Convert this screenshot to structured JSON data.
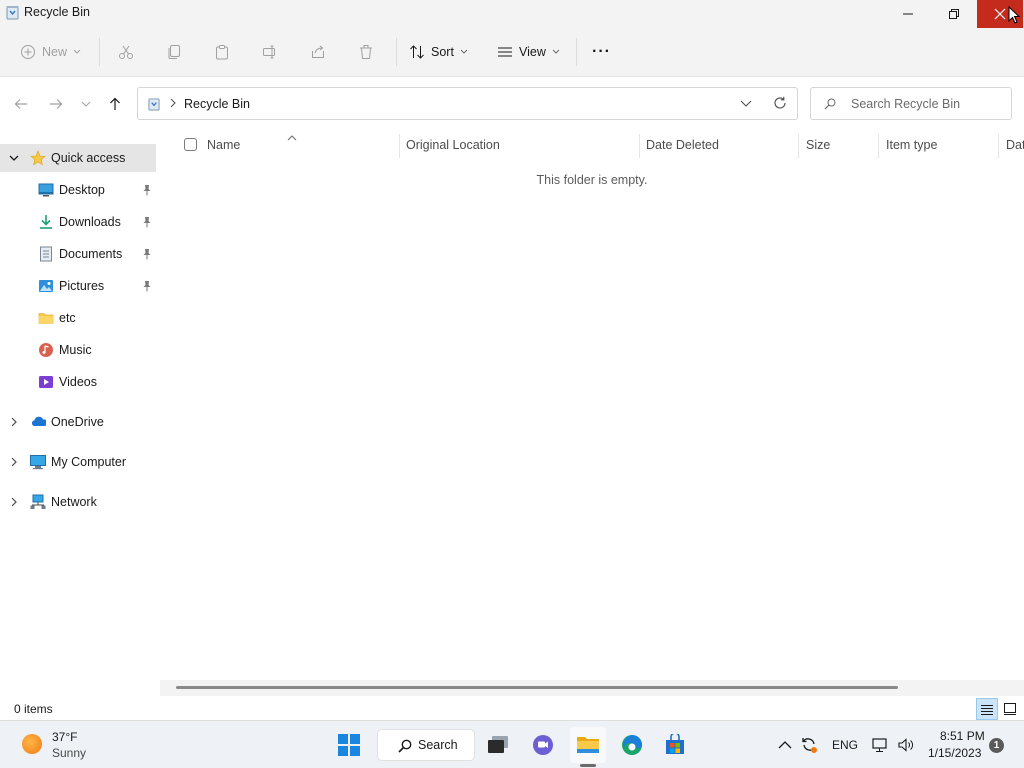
{
  "window": {
    "title": "Recycle Bin"
  },
  "commandbar": {
    "new_label": "New",
    "sort_label": "Sort",
    "view_label": "View",
    "more_label": "···"
  },
  "address": {
    "path": "Recycle Bin",
    "search_placeholder": "Search Recycle Bin"
  },
  "sidebar": {
    "quick_access": "Quick access",
    "items": [
      {
        "label": "Desktop",
        "icon": "desktop-icon",
        "pinned": true
      },
      {
        "label": "Downloads",
        "icon": "downloads-icon",
        "pinned": true
      },
      {
        "label": "Documents",
        "icon": "documents-icon",
        "pinned": true
      },
      {
        "label": "Pictures",
        "icon": "pictures-icon",
        "pinned": true
      },
      {
        "label": "etc",
        "icon": "folder-icon",
        "pinned": false
      },
      {
        "label": "Music",
        "icon": "music-icon",
        "pinned": false
      },
      {
        "label": "Videos",
        "icon": "videos-icon",
        "pinned": false
      }
    ],
    "onedrive": "OneDrive",
    "my_computer": "My Computer",
    "network": "Network"
  },
  "columns": {
    "name": "Name",
    "original_location": "Original Location",
    "date_deleted": "Date Deleted",
    "size": "Size",
    "item_type": "Item type",
    "date_modified": "Dat"
  },
  "content": {
    "empty_message": "This folder is empty."
  },
  "status": {
    "item_count": "0 items"
  },
  "taskbar": {
    "weather_temp": "37°F",
    "weather_desc": "Sunny",
    "search_label": "Search",
    "language": "ENG",
    "time": "8:51 PM",
    "date": "1/15/2023",
    "notification_count": "1"
  },
  "colors": {
    "accent": "#0067c0",
    "close_red": "#c42b1c",
    "selection": "#e5e5e5",
    "folder_yellow": "#f8c94a"
  }
}
